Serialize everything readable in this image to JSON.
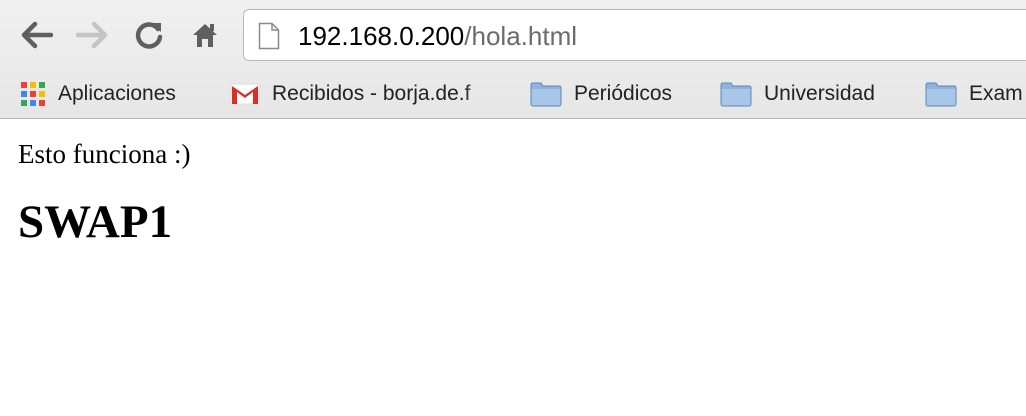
{
  "browser": {
    "nav": {
      "back_icon": "arrow-left-icon",
      "forward_icon": "arrow-right-icon",
      "reload_icon": "reload-icon",
      "home_icon": "home-icon"
    },
    "address_bar": {
      "host": "192.168.0.200",
      "path": "/hola.html",
      "page_icon": "document-icon"
    },
    "bookmarks": [
      {
        "label": "Aplicaciones",
        "icon": "apps-grid-icon"
      },
      {
        "label": "Recibidos - borja.de.f",
        "icon": "gmail-icon"
      },
      {
        "label": "Periódicos",
        "icon": "folder-icon"
      },
      {
        "label": "Universidad",
        "icon": "folder-icon"
      },
      {
        "label": "Exam",
        "icon": "folder-icon"
      }
    ]
  },
  "page": {
    "paragraph": "Esto funciona :)",
    "heading": "SWAP1"
  }
}
